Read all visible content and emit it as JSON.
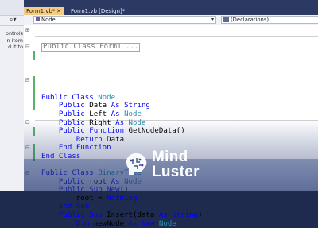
{
  "left_panel": {
    "search_icon": "search-icon",
    "lines": [
      "ontrols",
      "n item",
      "d it to"
    ]
  },
  "tabs": [
    {
      "label": "Form1.vb*",
      "active": true,
      "close": "✕"
    },
    {
      "label": "Form1.vb [Design]*",
      "active": false
    }
  ],
  "nav": {
    "left_label": "Node",
    "right_label": "(Declarations)"
  },
  "code": {
    "collapsed": "Public Class Form1 ...",
    "lines": [
      [
        {
          "k": "kw",
          "t": "Public"
        },
        {
          "k": "pl",
          "t": " "
        },
        {
          "k": "kw",
          "t": "Class"
        },
        {
          "k": "pl",
          "t": " "
        },
        {
          "k": "ty",
          "t": "Node"
        }
      ],
      [
        {
          "k": "pl",
          "t": "    "
        },
        {
          "k": "kw",
          "t": "Public"
        },
        {
          "k": "pl",
          "t": " Data "
        },
        {
          "k": "kw",
          "t": "As"
        },
        {
          "k": "pl",
          "t": " "
        },
        {
          "k": "kw",
          "t": "String"
        }
      ],
      [
        {
          "k": "pl",
          "t": "    "
        },
        {
          "k": "kw",
          "t": "Public"
        },
        {
          "k": "pl",
          "t": " Left "
        },
        {
          "k": "kw",
          "t": "As"
        },
        {
          "k": "pl",
          "t": " "
        },
        {
          "k": "ty",
          "t": "Node"
        }
      ],
      [
        {
          "k": "pl",
          "t": "    "
        },
        {
          "k": "kw",
          "t": "Public"
        },
        {
          "k": "pl",
          "t": " Right "
        },
        {
          "k": "kw",
          "t": "As"
        },
        {
          "k": "pl",
          "t": " "
        },
        {
          "k": "ty",
          "t": "Node"
        }
      ],
      [
        {
          "k": "pl",
          "t": "    "
        },
        {
          "k": "kw",
          "t": "Public"
        },
        {
          "k": "pl",
          "t": " "
        },
        {
          "k": "kw",
          "t": "Function"
        },
        {
          "k": "pl",
          "t": " GetNodeData()"
        }
      ],
      [
        {
          "k": "pl",
          "t": "        "
        },
        {
          "k": "kw",
          "t": "Return"
        },
        {
          "k": "pl",
          "t": " Data"
        }
      ],
      [
        {
          "k": "pl",
          "t": "    "
        },
        {
          "k": "kw",
          "t": "End"
        },
        {
          "k": "pl",
          "t": " "
        },
        {
          "k": "kw",
          "t": "Function"
        }
      ],
      [
        {
          "k": "kw",
          "t": "End"
        },
        {
          "k": "pl",
          "t": " "
        },
        {
          "k": "kw",
          "t": "Class"
        }
      ],
      [],
      [
        {
          "k": "kw",
          "t": "Public"
        },
        {
          "k": "pl",
          "t": " "
        },
        {
          "k": "kw",
          "t": "Class"
        },
        {
          "k": "pl",
          "t": " "
        },
        {
          "k": "ty",
          "t": "BinaryTree"
        }
      ],
      [
        {
          "k": "pl",
          "t": "    "
        },
        {
          "k": "kw",
          "t": "Public"
        },
        {
          "k": "pl",
          "t": " root "
        },
        {
          "k": "kw",
          "t": "As"
        },
        {
          "k": "pl",
          "t": " "
        },
        {
          "k": "ty",
          "t": "Node"
        }
      ],
      [
        {
          "k": "pl",
          "t": "    "
        },
        {
          "k": "kw",
          "t": "Public"
        },
        {
          "k": "pl",
          "t": " "
        },
        {
          "k": "kw",
          "t": "Sub"
        },
        {
          "k": "pl",
          "t": " "
        },
        {
          "k": "kw",
          "t": "New"
        },
        {
          "k": "pl",
          "t": "()"
        }
      ],
      [
        {
          "k": "pl",
          "t": "        root = "
        },
        {
          "k": "kw",
          "t": "Nothing"
        }
      ],
      [
        {
          "k": "pl",
          "t": "    "
        },
        {
          "k": "kw",
          "t": "End"
        },
        {
          "k": "pl",
          "t": " "
        },
        {
          "k": "kw",
          "t": "Sub"
        }
      ],
      [
        {
          "k": "pl",
          "t": "    "
        },
        {
          "k": "kw",
          "t": "Public"
        },
        {
          "k": "pl",
          "t": " "
        },
        {
          "k": "kw",
          "t": "Sub"
        },
        {
          "k": "pl",
          "t": " Insert(data "
        },
        {
          "k": "kw",
          "t": "As"
        },
        {
          "k": "pl",
          "t": " "
        },
        {
          "k": "kw",
          "t": "String"
        },
        {
          "k": "pl",
          "t": ")"
        }
      ],
      [
        {
          "k": "pl",
          "t": "        "
        },
        {
          "k": "kw",
          "t": "Dim"
        },
        {
          "k": "pl",
          "t": " newNode "
        },
        {
          "k": "kw",
          "t": "As"
        },
        {
          "k": "pl",
          "t": " "
        },
        {
          "k": "kw",
          "t": "New"
        },
        {
          "k": "pl",
          "t": " "
        },
        {
          "k": "ty",
          "t": "Node"
        }
      ]
    ]
  },
  "watermark": {
    "line1": "Mind",
    "line2": "Luster"
  },
  "colors": {
    "keyword": "#0000ff",
    "type": "#2b91af",
    "active_tab": "#f5cc84",
    "change_bar": "#57b36b"
  }
}
